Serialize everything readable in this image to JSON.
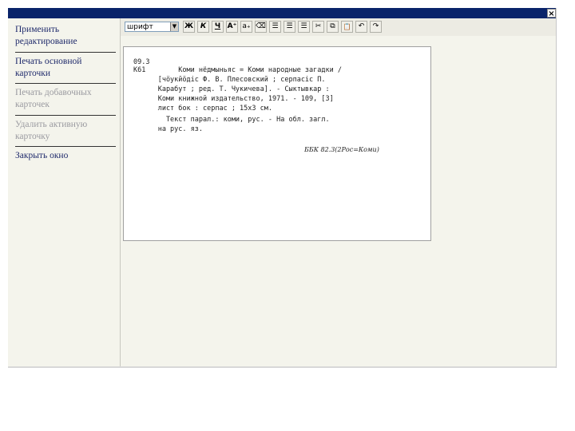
{
  "window": {
    "close_symbol": "×"
  },
  "sidebar": {
    "items": [
      {
        "lines": [
          "Применить",
          "редактирование"
        ],
        "enabled": true
      },
      {
        "lines": [
          "Печать основной",
          "карточки"
        ],
        "enabled": true
      },
      {
        "lines": [
          "Печать добавочных",
          "карточек"
        ],
        "enabled": false
      },
      {
        "lines": [
          "Удалить активную",
          "карточку"
        ],
        "enabled": false
      },
      {
        "lines": [
          "Закрыть окно"
        ],
        "enabled": true
      }
    ]
  },
  "toolbar": {
    "font_value": "шрифт",
    "buttons": [
      {
        "name": "bold-button",
        "glyph": "Ж"
      },
      {
        "name": "italic-button",
        "glyph": "К"
      },
      {
        "name": "underline-button",
        "glyph": "Ч"
      },
      {
        "name": "superscript-button",
        "glyph": "A⁺"
      },
      {
        "name": "subscript-button",
        "glyph": "a₊"
      },
      {
        "name": "eraser-button",
        "glyph": "⌫"
      },
      {
        "name": "align-left-button",
        "glyph": "☰"
      },
      {
        "name": "align-center-button",
        "glyph": "☰"
      },
      {
        "name": "align-right-button",
        "glyph": "☰"
      },
      {
        "name": "cut-button",
        "glyph": "✂"
      },
      {
        "name": "copy-button",
        "glyph": "⧉"
      },
      {
        "name": "paste-button",
        "glyph": "📋"
      },
      {
        "name": "undo-button",
        "glyph": "↶"
      },
      {
        "name": "redo-button",
        "glyph": "↷"
      }
    ]
  },
  "card": {
    "lines": [
      "09.3",
      "К61        Коми нёдмыньяс = Коми народные загадки /",
      "      [чöукйöдiс Ф. В. Плесовский ; серпасiс П.",
      "      Карабут ; ред. Т. Чукичева]. - Сыктывкар :",
      "      Коми книжной издательство, 1971. - 109, [3]",
      "      лист бок : серпас ; 15x3 см.",
      "        Текст парал.: коми, рус. - На обл. загл.",
      "      на рус. яз."
    ],
    "bbk": "ББК 82.3(2Рос=Коми)"
  }
}
